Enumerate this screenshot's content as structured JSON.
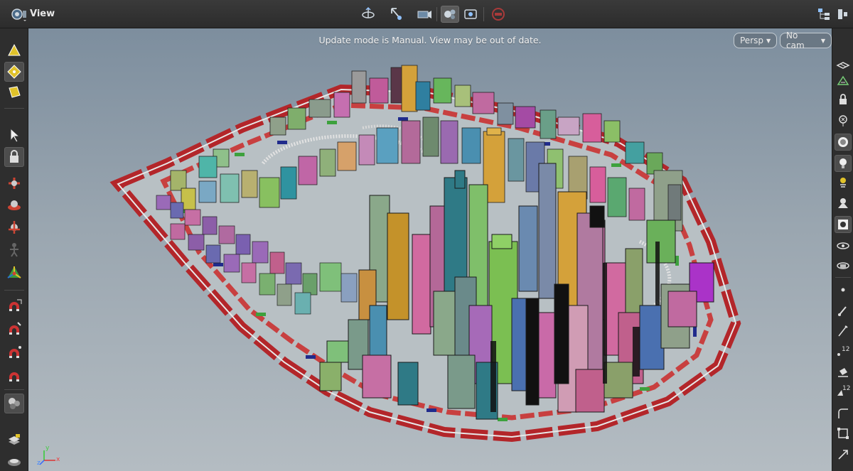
{
  "header": {
    "title": "View",
    "icons": [
      "viewer-pane-icon",
      "tumble-view-icon",
      "pan-view-icon",
      "dolly-view-icon",
      "display-options-icon",
      "snapshot-icon",
      "stop-icon",
      "tree-menu-icon"
    ]
  },
  "viewport": {
    "status_message": "Update mode is Manual. View may be out of date.",
    "camera_menu": "Persp",
    "cam_menu": "No cam",
    "axis_labels": {
      "x": "x",
      "y": "y",
      "z": "z"
    }
  },
  "left_toolbar": {
    "tools": [
      "select-object-icon",
      "select-points-icon",
      "select-prims-icon",
      "select-arrow-icon",
      "lock-icon",
      "view-tool-icon",
      "handle-tool-icon",
      "pose-tool-icon",
      "paint-tool-icon",
      "transform-handle-icon",
      "snap-grid-icon",
      "snap-prim-icon",
      "snap-point-icon",
      "snap-multi-icon",
      "render-region-icon",
      "layers-icon",
      "display-flag-icon"
    ]
  },
  "right_toolbar": {
    "badge_12a": "12",
    "badge_12b": "12",
    "tools": [
      "ground-plane-icon",
      "shading-icon",
      "lock-icon",
      "close-x-icon",
      "circle-icon",
      "light-icon",
      "headlight-icon",
      "ambient-light-icon",
      "display-options-icon",
      "visibility-icon",
      "ghost-icon",
      "point-icon",
      "brush-icon",
      "pen-icon",
      "vertex-numbers-icon",
      "paint-bucket-icon",
      "prim-numbers-icon",
      "corner-icon",
      "bounding-box-icon",
      "resize-icon"
    ]
  },
  "colors": {
    "viewport_top": "#7d8e9e",
    "viewport_bottom": "#b4bcc2",
    "road_red": "#b3262a",
    "road_white": "#e8e8e8",
    "accent_green": "#3da13d",
    "accent_blue": "#202b8c"
  }
}
